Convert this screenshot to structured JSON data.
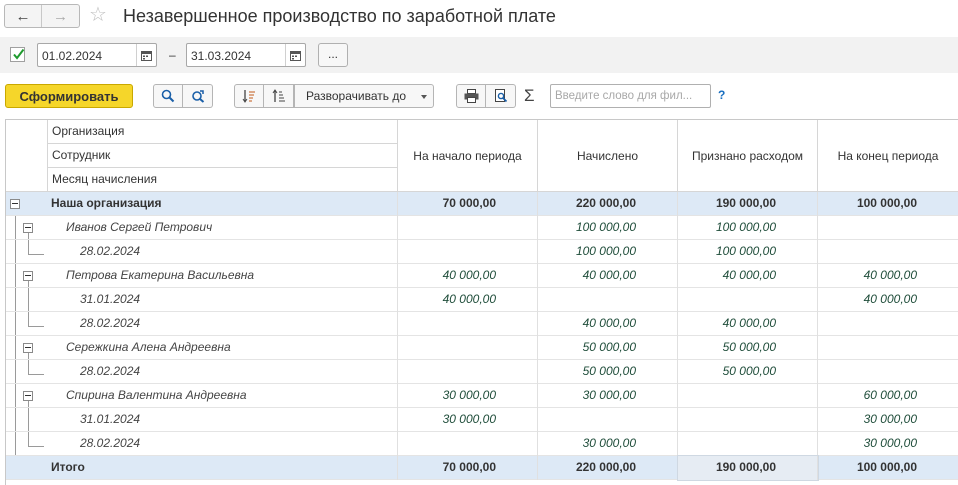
{
  "window": {
    "title": "Незавершенное производство по заработной плате"
  },
  "period": {
    "date_from": "01.02.2024",
    "date_to": "31.03.2024",
    "dash": "–",
    "more_label": "..."
  },
  "toolbar": {
    "generate_label": "Сформировать",
    "expand_label": "Разворачивать до",
    "sigma": "Σ",
    "search_placeholder": "Введите слово для фил...",
    "help": "?"
  },
  "table": {
    "header_groupings": [
      "Организация",
      "Сотрудник",
      "Месяц начисления"
    ],
    "columns": [
      "На начало периода",
      "Начислено",
      "Признано расходом",
      "На конец периода"
    ],
    "rows": [
      {
        "level": 0,
        "name": "Наша организация",
        "v": [
          "70 000,00",
          "220 000,00",
          "190 000,00",
          "100 000,00"
        ]
      },
      {
        "level": 1,
        "name": "Иванов Сергей Петрович",
        "v": [
          "",
          "100 000,00",
          "100 000,00",
          ""
        ]
      },
      {
        "level": 2,
        "name": "28.02.2024",
        "v": [
          "",
          "100 000,00",
          "100 000,00",
          ""
        ]
      },
      {
        "level": 1,
        "name": "Петрова Екатерина Васильевна",
        "v": [
          "40 000,00",
          "40 000,00",
          "40 000,00",
          "40 000,00"
        ]
      },
      {
        "level": 2,
        "name": "31.01.2024",
        "v": [
          "40 000,00",
          "",
          "",
          "40 000,00"
        ]
      },
      {
        "level": 2,
        "name": "28.02.2024",
        "v": [
          "",
          "40 000,00",
          "40 000,00",
          ""
        ]
      },
      {
        "level": 1,
        "name": "Сережкина Алена Андреевна",
        "v": [
          "",
          "50 000,00",
          "50 000,00",
          ""
        ]
      },
      {
        "level": 2,
        "name": "28.02.2024",
        "v": [
          "",
          "50 000,00",
          "50 000,00",
          ""
        ]
      },
      {
        "level": 1,
        "name": "Спирина Валентина Андреевна",
        "v": [
          "30 000,00",
          "30 000,00",
          "",
          "60 000,00"
        ]
      },
      {
        "level": 2,
        "name": "31.01.2024",
        "v": [
          "30 000,00",
          "",
          "",
          "30 000,00"
        ]
      },
      {
        "level": 2,
        "name": "28.02.2024",
        "v": [
          "",
          "30 000,00",
          "",
          "30 000,00"
        ]
      }
    ],
    "total": {
      "name": "Итого",
      "v": [
        "70 000,00",
        "220 000,00",
        "190 000,00",
        "100 000,00"
      ]
    }
  },
  "colors": {
    "primary_button": "#f5d62a",
    "group_row": "#dde9f6",
    "amount_text": "#1f4d3a"
  }
}
